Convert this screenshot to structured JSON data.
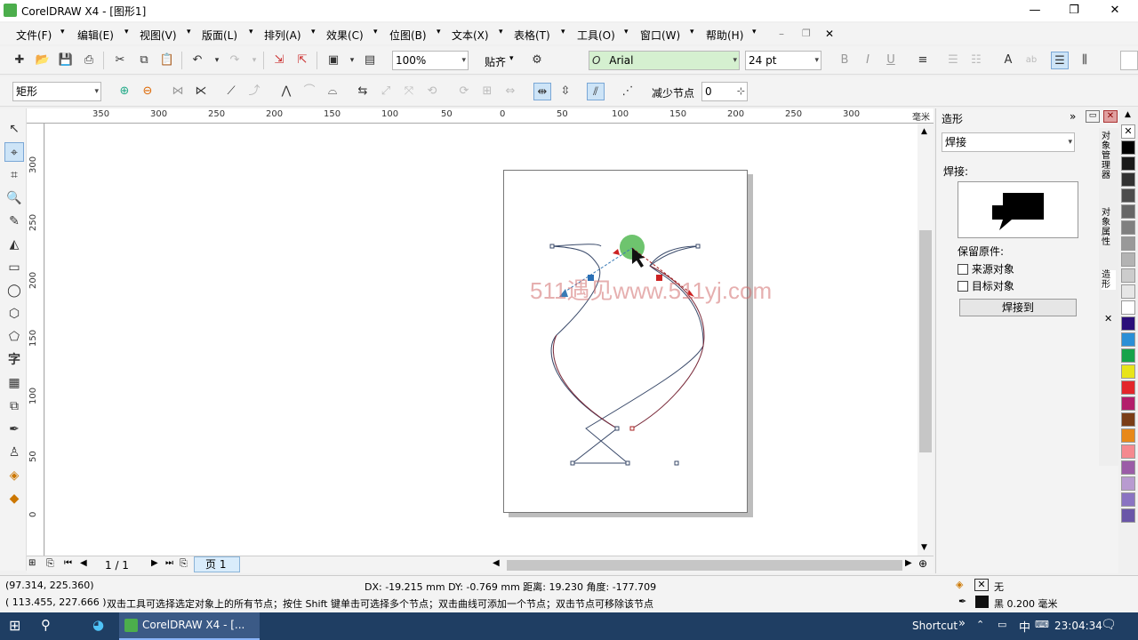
{
  "window": {
    "title": "CorelDRAW X4 - [图形1]"
  },
  "menu": [
    "文件(F)",
    "编辑(E)",
    "视图(V)",
    "版面(L)",
    "排列(A)",
    "效果(C)",
    "位图(B)",
    "文本(X)",
    "表格(T)",
    "工具(O)",
    "窗口(W)",
    "帮助(H)"
  ],
  "toolbar": {
    "zoom": "100%",
    "snap": "贴齐",
    "font": "Arial",
    "font_size": "24 pt"
  },
  "property_bar": {
    "shape_type": "矩形",
    "reduce_nodes_label": "减少节点",
    "reduce_nodes_value": "0"
  },
  "ruler": {
    "h_labels": [
      "350",
      "300",
      "250",
      "200",
      "150",
      "100",
      "50",
      "0",
      "50",
      "100",
      "150",
      "200",
      "250",
      "300",
      "毫米"
    ],
    "v_labels": [
      "300",
      "250",
      "200",
      "150",
      "100",
      "50",
      "0"
    ]
  },
  "watermark": "511遇见www.511yj.com",
  "page_nav": {
    "count": "1 / 1",
    "tab": "页 1"
  },
  "docker": {
    "title": "造形",
    "mode": "焊接",
    "section_label": "焊接:",
    "preserve_label": "保留原件:",
    "option_source": "来源对象",
    "option_target": "目标对象",
    "apply_button": "焊接到"
  },
  "side_tabs": [
    "对象管理器",
    "对象属性",
    "造形"
  ],
  "palette": [
    "#ffffff",
    "#000000",
    "#1a1a1a",
    "#333333",
    "#4d4d4d",
    "#666666",
    "#808080",
    "#999999",
    "#b3b3b3",
    "#cccccc",
    "#e6e6e6",
    "#ffffff",
    "#2b0f7a",
    "#2a8fd6",
    "#16a34a",
    "#e8e41a",
    "#e3262b",
    "#b31e6b",
    "#7a3d17",
    "#e8891a",
    "#f5898f",
    "#9b5ca7",
    "#b89bd0",
    "#8a74c2",
    "#6a56a8"
  ],
  "status": {
    "cursor_pos": "(97.314, 225.360)",
    "delta": "DX: -19.215 mm DY: -0.769 mm 距离: 19.230 角度: -177.709",
    "node_pos": "( 113.455, 227.666 )",
    "hint": "双击工具可选择选定对象上的所有节点；按住 Shift 键单击可选择多个节点；双击曲线可添加一个节点；双击节点可移除该节点",
    "fill_label": "无",
    "outline_label": "黑  0.200 毫米"
  },
  "taskbar": {
    "app": "CorelDRAW X4 - [...",
    "shortcut": "Shortcut",
    "ime": "中",
    "time": "23:04:34"
  }
}
